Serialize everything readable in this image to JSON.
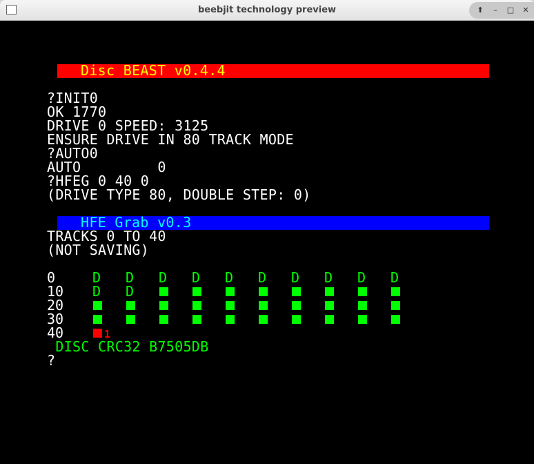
{
  "window": {
    "title": "beebjit technology preview",
    "controls": [
      "up",
      "minimize",
      "maximize",
      "close"
    ]
  },
  "banner_disc": "Disc BEAST v0.4.4",
  "lines_1": [
    "?INIT0",
    "OK 1770",
    "DRIVE 0 SPEED: 3125",
    "ENSURE DRIVE IN 80 TRACK MODE",
    "?AUTO0",
    "AUTO         0",
    "?HFEG 0 40 0",
    "(DRIVE TYPE 80, DOUBLE STEP: 0)"
  ],
  "banner_hfe": "HFE Grab v0.3",
  "lines_2": [
    "TRACKS 0 TO 40",
    "(NOT SAVING)"
  ],
  "track_grid": [
    {
      "label": "0",
      "cells": [
        "D",
        "D",
        "D",
        "D",
        "D",
        "D",
        "D",
        "D",
        "D",
        "D"
      ]
    },
    {
      "label": "10",
      "cells": [
        "D",
        "D",
        "■",
        "■",
        "■",
        "■",
        "■",
        "■",
        "■",
        "■"
      ]
    },
    {
      "label": "20",
      "cells": [
        "■",
        "■",
        "■",
        "■",
        "■",
        "■",
        "■",
        "■",
        "■",
        "■"
      ]
    },
    {
      "label": "30",
      "cells": [
        "■",
        "■",
        "■",
        "■",
        "■",
        "■",
        "■",
        "■",
        "■",
        "■"
      ]
    },
    {
      "label": "40",
      "cells": [
        "■"
      ],
      "cell_colors": [
        "red"
      ],
      "note": "1"
    }
  ],
  "crc_line": " DISC CRC32 B7505DB",
  "prompt": "?",
  "colors": {
    "background": "#000000",
    "text": "#ffffff",
    "good": "#00ff00",
    "error": "#ff0000",
    "disc_banner_bg": "#ff0000",
    "disc_banner_fg": "#ffff00",
    "hfe_banner_bg": "#0000ff",
    "hfe_banner_fg": "#00ffff"
  }
}
